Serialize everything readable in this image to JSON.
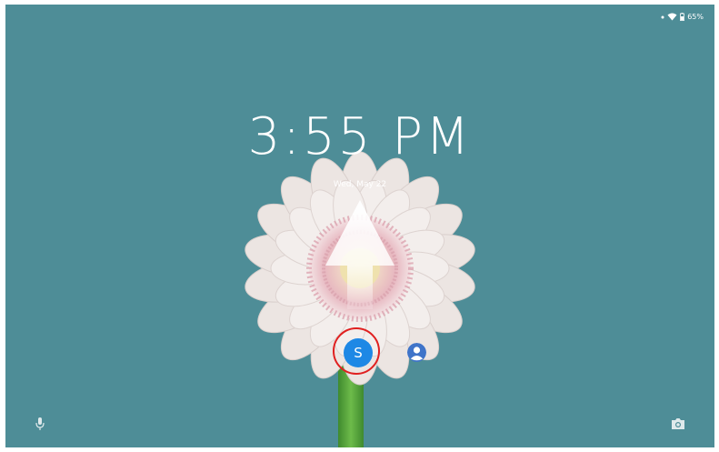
{
  "status_bar": {
    "battery_level": "65%",
    "icons": [
      "signal-dot-icon",
      "wifi-icon",
      "battery-icon"
    ]
  },
  "lock_screen": {
    "time": "3:55 PM",
    "date": "Wed, May 22",
    "swipe_hint_icon": "arrow-up-icon",
    "wallpaper": "pink-gerbera-daisy"
  },
  "users": {
    "current_initial": "S",
    "other_user_icon": "person-icon"
  },
  "shortcuts": {
    "left_icon": "microphone-icon",
    "right_icon": "camera-icon"
  },
  "colors": {
    "background": "#4e8d97",
    "user_avatar": "#1e88e5",
    "highlight": "#e02020"
  }
}
